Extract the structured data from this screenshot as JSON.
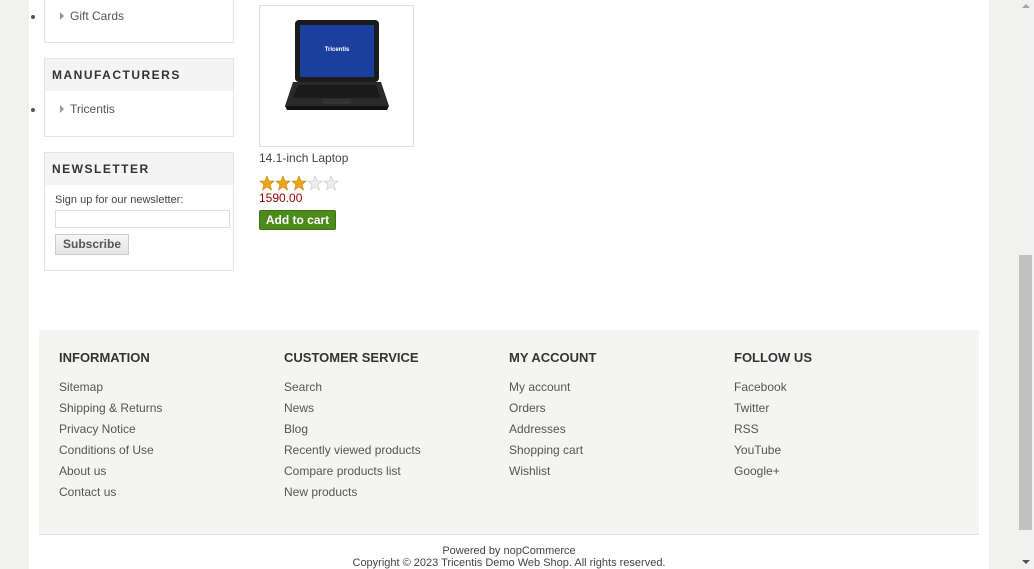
{
  "sidebar": {
    "categories": {
      "items": [
        {
          "label": "Gift Cards"
        }
      ]
    },
    "manufacturers": {
      "title": "Manufacturers",
      "items": [
        {
          "label": "Tricentis"
        }
      ]
    },
    "newsletter": {
      "title": "Newsletter",
      "label": "Sign up for our newsletter:",
      "input_value": "",
      "button": "Subscribe"
    }
  },
  "product": {
    "title": "14.1-inch Laptop",
    "screen_logo": "Tricentis",
    "rating": {
      "value": 3,
      "max": 5,
      "filled_color": "#f2a516",
      "empty_color": "#dcdcdc"
    },
    "price": "1590.00",
    "add_to_cart": "Add to cart"
  },
  "footer": {
    "information": {
      "title": "Information",
      "links": [
        "Sitemap",
        "Shipping & Returns",
        "Privacy Notice",
        "Conditions of Use",
        "About us",
        "Contact us"
      ]
    },
    "customer_service": {
      "title": "Customer service",
      "links": [
        "Search",
        "News",
        "Blog",
        "Recently viewed products",
        "Compare products list",
        "New products"
      ]
    },
    "my_account": {
      "title": "My account",
      "links": [
        "My account",
        "Orders",
        "Addresses",
        "Shopping cart",
        "Wishlist"
      ]
    },
    "follow_us": {
      "title": "Follow us",
      "links": [
        "Facebook",
        "Twitter",
        "RSS",
        "YouTube",
        "Google+"
      ]
    },
    "powered_prefix": "Powered by",
    "powered_link": "nopCommerce",
    "copyright": "Copyright © 2023 Tricentis Demo Web Shop. All rights reserved."
  },
  "colors": {
    "price": "#990000",
    "add_to_cart_bg": "#4d8a1c",
    "footer_bg": "#f4f4f2",
    "page_bg": "#f1f1f0"
  }
}
